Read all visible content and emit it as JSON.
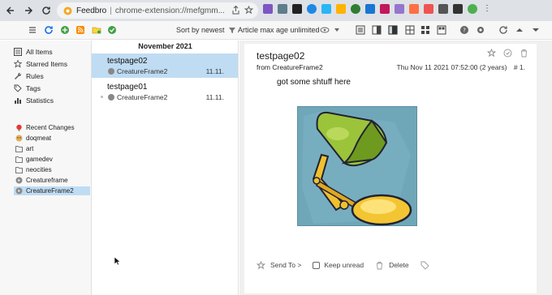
{
  "browser": {
    "site_label": "Feedbro",
    "url": "chrome-extension://mefgmm...",
    "colors": {
      "accent": "#1a73e8"
    }
  },
  "toolbar": {
    "sort_label": "Sort by newest",
    "filter_label": "Article max age unlimited"
  },
  "sidebar": {
    "nav": [
      {
        "label": "All Items",
        "icon": "list-icon"
      },
      {
        "label": "Starred Items",
        "icon": "star-icon"
      },
      {
        "label": "Rules",
        "icon": "wrench-icon"
      },
      {
        "label": "Tags",
        "icon": "tag-icon"
      },
      {
        "label": "Statistics",
        "icon": "bar-chart-icon"
      }
    ],
    "feeds": [
      {
        "label": "Recent Changes",
        "icon": "red-rose-icon"
      },
      {
        "label": "doqmeat",
        "icon": "doge-icon"
      },
      {
        "label": "art",
        "icon": "folder-icon"
      },
      {
        "label": "gamedev",
        "icon": "folder-icon"
      },
      {
        "label": "neocities",
        "icon": "folder-icon"
      },
      {
        "label": "Creatureframe",
        "icon": "feed-circle-icon"
      },
      {
        "label": "CreatureFrame2",
        "icon": "feed-circle-icon",
        "selected": true
      }
    ]
  },
  "list": {
    "header": "November 2021",
    "articles": [
      {
        "title": "testpage02",
        "feed": "CreatureFrame2",
        "date": "11.11.",
        "selected": true
      },
      {
        "title": "testpage01",
        "feed": "CreatureFrame2",
        "date": "11.11.",
        "selected": false
      }
    ]
  },
  "reader": {
    "title": "testpage02",
    "from": "from CreatureFrame2",
    "date": "Thu Nov 11 2021 07:52:00 (2 years)",
    "index": "# 1.",
    "body": "got some shtuff here",
    "actions": {
      "send_to": "Send To >",
      "keep_unread": "Keep unread",
      "delete": "Delete"
    }
  }
}
